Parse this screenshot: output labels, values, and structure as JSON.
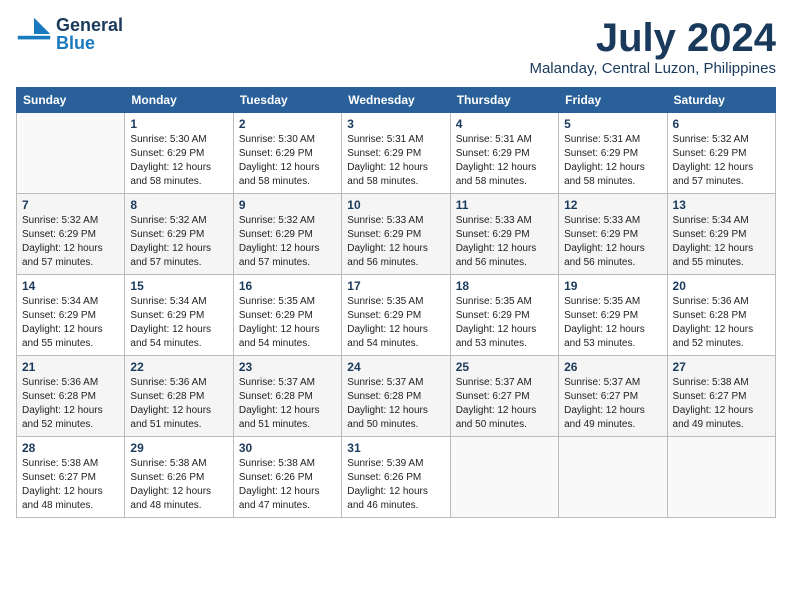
{
  "header": {
    "logo_general": "General",
    "logo_blue": "Blue",
    "month": "July 2024",
    "location": "Malanday, Central Luzon, Philippines"
  },
  "days_of_week": [
    "Sunday",
    "Monday",
    "Tuesday",
    "Wednesday",
    "Thursday",
    "Friday",
    "Saturday"
  ],
  "weeks": [
    [
      {
        "day": "",
        "info": ""
      },
      {
        "day": "1",
        "info": "Sunrise: 5:30 AM\nSunset: 6:29 PM\nDaylight: 12 hours\nand 58 minutes."
      },
      {
        "day": "2",
        "info": "Sunrise: 5:30 AM\nSunset: 6:29 PM\nDaylight: 12 hours\nand 58 minutes."
      },
      {
        "day": "3",
        "info": "Sunrise: 5:31 AM\nSunset: 6:29 PM\nDaylight: 12 hours\nand 58 minutes."
      },
      {
        "day": "4",
        "info": "Sunrise: 5:31 AM\nSunset: 6:29 PM\nDaylight: 12 hours\nand 58 minutes."
      },
      {
        "day": "5",
        "info": "Sunrise: 5:31 AM\nSunset: 6:29 PM\nDaylight: 12 hours\nand 58 minutes."
      },
      {
        "day": "6",
        "info": "Sunrise: 5:32 AM\nSunset: 6:29 PM\nDaylight: 12 hours\nand 57 minutes."
      }
    ],
    [
      {
        "day": "7",
        "info": "Sunrise: 5:32 AM\nSunset: 6:29 PM\nDaylight: 12 hours\nand 57 minutes."
      },
      {
        "day": "8",
        "info": "Sunrise: 5:32 AM\nSunset: 6:29 PM\nDaylight: 12 hours\nand 57 minutes."
      },
      {
        "day": "9",
        "info": "Sunrise: 5:32 AM\nSunset: 6:29 PM\nDaylight: 12 hours\nand 57 minutes."
      },
      {
        "day": "10",
        "info": "Sunrise: 5:33 AM\nSunset: 6:29 PM\nDaylight: 12 hours\nand 56 minutes."
      },
      {
        "day": "11",
        "info": "Sunrise: 5:33 AM\nSunset: 6:29 PM\nDaylight: 12 hours\nand 56 minutes."
      },
      {
        "day": "12",
        "info": "Sunrise: 5:33 AM\nSunset: 6:29 PM\nDaylight: 12 hours\nand 56 minutes."
      },
      {
        "day": "13",
        "info": "Sunrise: 5:34 AM\nSunset: 6:29 PM\nDaylight: 12 hours\nand 55 minutes."
      }
    ],
    [
      {
        "day": "14",
        "info": "Sunrise: 5:34 AM\nSunset: 6:29 PM\nDaylight: 12 hours\nand 55 minutes."
      },
      {
        "day": "15",
        "info": "Sunrise: 5:34 AM\nSunset: 6:29 PM\nDaylight: 12 hours\nand 54 minutes."
      },
      {
        "day": "16",
        "info": "Sunrise: 5:35 AM\nSunset: 6:29 PM\nDaylight: 12 hours\nand 54 minutes."
      },
      {
        "day": "17",
        "info": "Sunrise: 5:35 AM\nSunset: 6:29 PM\nDaylight: 12 hours\nand 54 minutes."
      },
      {
        "day": "18",
        "info": "Sunrise: 5:35 AM\nSunset: 6:29 PM\nDaylight: 12 hours\nand 53 minutes."
      },
      {
        "day": "19",
        "info": "Sunrise: 5:35 AM\nSunset: 6:29 PM\nDaylight: 12 hours\nand 53 minutes."
      },
      {
        "day": "20",
        "info": "Sunrise: 5:36 AM\nSunset: 6:28 PM\nDaylight: 12 hours\nand 52 minutes."
      }
    ],
    [
      {
        "day": "21",
        "info": "Sunrise: 5:36 AM\nSunset: 6:28 PM\nDaylight: 12 hours\nand 52 minutes."
      },
      {
        "day": "22",
        "info": "Sunrise: 5:36 AM\nSunset: 6:28 PM\nDaylight: 12 hours\nand 51 minutes."
      },
      {
        "day": "23",
        "info": "Sunrise: 5:37 AM\nSunset: 6:28 PM\nDaylight: 12 hours\nand 51 minutes."
      },
      {
        "day": "24",
        "info": "Sunrise: 5:37 AM\nSunset: 6:28 PM\nDaylight: 12 hours\nand 50 minutes."
      },
      {
        "day": "25",
        "info": "Sunrise: 5:37 AM\nSunset: 6:27 PM\nDaylight: 12 hours\nand 50 minutes."
      },
      {
        "day": "26",
        "info": "Sunrise: 5:37 AM\nSunset: 6:27 PM\nDaylight: 12 hours\nand 49 minutes."
      },
      {
        "day": "27",
        "info": "Sunrise: 5:38 AM\nSunset: 6:27 PM\nDaylight: 12 hours\nand 49 minutes."
      }
    ],
    [
      {
        "day": "28",
        "info": "Sunrise: 5:38 AM\nSunset: 6:27 PM\nDaylight: 12 hours\nand 48 minutes."
      },
      {
        "day": "29",
        "info": "Sunrise: 5:38 AM\nSunset: 6:26 PM\nDaylight: 12 hours\nand 48 minutes."
      },
      {
        "day": "30",
        "info": "Sunrise: 5:38 AM\nSunset: 6:26 PM\nDaylight: 12 hours\nand 47 minutes."
      },
      {
        "day": "31",
        "info": "Sunrise: 5:39 AM\nSunset: 6:26 PM\nDaylight: 12 hours\nand 46 minutes."
      },
      {
        "day": "",
        "info": ""
      },
      {
        "day": "",
        "info": ""
      },
      {
        "day": "",
        "info": ""
      }
    ]
  ]
}
